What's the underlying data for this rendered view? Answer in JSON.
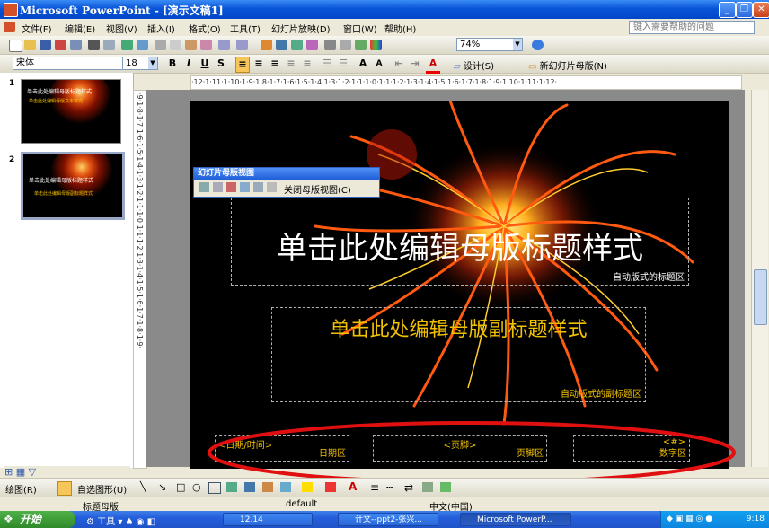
{
  "window": {
    "title": "Microsoft PowerPoint - [演示文稿1]",
    "help_placeholder": "键入需要帮助的问题"
  },
  "menubar": {
    "items": [
      "文件(F)",
      "编辑(E)",
      "视图(V)",
      "插入(I)",
      "格式(O)",
      "工具(T)",
      "幻灯片放映(D)",
      "窗口(W)",
      "帮助(H)"
    ]
  },
  "toolbar_standard": {
    "zoom": "74%"
  },
  "toolbar_format": {
    "font": "宋体",
    "size": "18",
    "design_label": "设计(S)",
    "new_master_label": "新幻灯片母版(N)"
  },
  "ruler": {
    "horizontal": "·12·1·11·1·10·1·9·1·8·1·7·1·6·1·5·1·4·1·3·1·2·1·1·1·0·1·1·1·2·1·3·1·4·1·5·1·6·1·7·1·8·1·9·1·10·1·11·1·12·",
    "vertical": "·9·1·8·1·7·1·6·1·5·1·4·1·3·1·2·1·1·1·0·1·1·1·2·1·3·1·4·1·5·1·6·1·7·1·8·1·9·"
  },
  "thumbnails": {
    "one": {
      "number": "1",
      "title": "单击此处编辑母版标题样式",
      "body": "单击此处编辑母版文本样式"
    },
    "two": {
      "number": "2",
      "title": "单击此处编辑母版标题样式",
      "body": "单击此处编辑母版副标题样式"
    }
  },
  "master_toolbar": {
    "title": "幻灯片母版视图",
    "close_label": "关闭母版视图(C)"
  },
  "slide": {
    "title_text": "单击此处编辑母版标题样式",
    "title_area_label": "自动版式的标题区",
    "subtitle_text": "单击此处编辑母版副标题样式",
    "subtitle_area_label": "自动版式的副标题区",
    "date_text": "<日期/时间>",
    "date_label": "日期区",
    "footer_text": "<页脚>",
    "footer_label": "页脚区",
    "number_text": "<#>",
    "number_label": "数字区"
  },
  "drawbar": {
    "draw_label": "绘图(R)",
    "autoshape_label": "自选图形(U)"
  },
  "status": {
    "view": "标题母版",
    "design": "default",
    "language": "中文(中国)"
  },
  "taskbar": {
    "start": "开始",
    "tools_label": "工具",
    "folder": "12.14",
    "task1": "计文--ppt2-张兴...",
    "task2": "Microsoft PowerP...",
    "clock": "9:18"
  },
  "colors": {
    "accent_red": "#e01010",
    "slide_bg": "#000000",
    "subtitle_color": "#f2c200"
  }
}
